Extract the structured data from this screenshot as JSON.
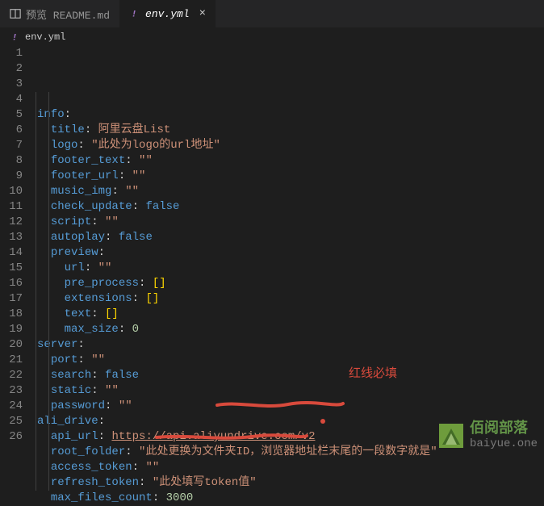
{
  "tabs": {
    "preview": {
      "label": "预览 README.md"
    },
    "active": {
      "label": "env.yml"
    }
  },
  "breadcrumb": {
    "file": "env.yml"
  },
  "annotation": {
    "red_text": "红线必填"
  },
  "watermark": {
    "line1": "佰阅部落",
    "line2": "baiyue.one"
  },
  "lines": [
    {
      "n": "1",
      "indent": "",
      "key": "info",
      "colon": ":"
    },
    {
      "n": "2",
      "indent": "  ",
      "key": "title",
      "colon": ": ",
      "val": "阿里云盘List",
      "type": "str_plain"
    },
    {
      "n": "3",
      "indent": "  ",
      "key": "logo",
      "colon": ": ",
      "val": "\"此处为logo的url地址\"",
      "type": "str"
    },
    {
      "n": "4",
      "indent": "  ",
      "key": "footer_text",
      "colon": ": ",
      "val": "\"\"",
      "type": "str"
    },
    {
      "n": "5",
      "indent": "  ",
      "key": "footer_url",
      "colon": ": ",
      "val": "\"\"",
      "type": "str"
    },
    {
      "n": "6",
      "indent": "  ",
      "key": "music_img",
      "colon": ": ",
      "val": "\"\"",
      "type": "str"
    },
    {
      "n": "7",
      "indent": "  ",
      "key": "check_update",
      "colon": ": ",
      "val": "false",
      "type": "bool"
    },
    {
      "n": "8",
      "indent": "  ",
      "key": "script",
      "colon": ": ",
      "val": "\"\"",
      "type": "str"
    },
    {
      "n": "9",
      "indent": "  ",
      "key": "autoplay",
      "colon": ": ",
      "val": "false",
      "type": "bool"
    },
    {
      "n": "10",
      "indent": "  ",
      "key": "preview",
      "colon": ":"
    },
    {
      "n": "11",
      "indent": "    ",
      "key": "url",
      "colon": ": ",
      "val": "\"\"",
      "type": "str"
    },
    {
      "n": "12",
      "indent": "    ",
      "key": "pre_process",
      "colon": ": ",
      "val": "[]",
      "type": "bracket"
    },
    {
      "n": "13",
      "indent": "    ",
      "key": "extensions",
      "colon": ": ",
      "val": "[]",
      "type": "bracket"
    },
    {
      "n": "14",
      "indent": "    ",
      "key": "text",
      "colon": ": ",
      "val": "[]",
      "type": "bracket"
    },
    {
      "n": "15",
      "indent": "    ",
      "key": "max_size",
      "colon": ": ",
      "val": "0",
      "type": "num"
    },
    {
      "n": "16",
      "indent": "",
      "key": "server",
      "colon": ":"
    },
    {
      "n": "17",
      "indent": "  ",
      "key": "port",
      "colon": ": ",
      "val": "\"\"",
      "type": "str"
    },
    {
      "n": "18",
      "indent": "  ",
      "key": "search",
      "colon": ": ",
      "val": "false",
      "type": "bool"
    },
    {
      "n": "19",
      "indent": "  ",
      "key": "static",
      "colon": ": ",
      "val": "\"\"",
      "type": "str"
    },
    {
      "n": "20",
      "indent": "  ",
      "key": "password",
      "colon": ": ",
      "val": "\"\"",
      "type": "str"
    },
    {
      "n": "21",
      "indent": "",
      "key": "ali_drive",
      "colon": ":"
    },
    {
      "n": "22",
      "indent": "  ",
      "key": "api_url",
      "colon": ": ",
      "val": "https://api.aliyundrive.com/v2",
      "type": "url"
    },
    {
      "n": "23",
      "indent": "  ",
      "key": "root_folder",
      "colon": ": ",
      "val": "\"此处更换为文件夹ID，浏览器地址栏末尾的一段数字就是\"",
      "type": "str"
    },
    {
      "n": "24",
      "indent": "  ",
      "key": "access_token",
      "colon": ": ",
      "val": "\"\"",
      "type": "str"
    },
    {
      "n": "25",
      "indent": "  ",
      "key": "refresh_token",
      "colon": ": ",
      "val": "\"此处填写token值\"",
      "type": "str"
    },
    {
      "n": "26",
      "indent": "  ",
      "key": "max_files_count",
      "colon": ": ",
      "val": "3000",
      "type": "num"
    }
  ]
}
